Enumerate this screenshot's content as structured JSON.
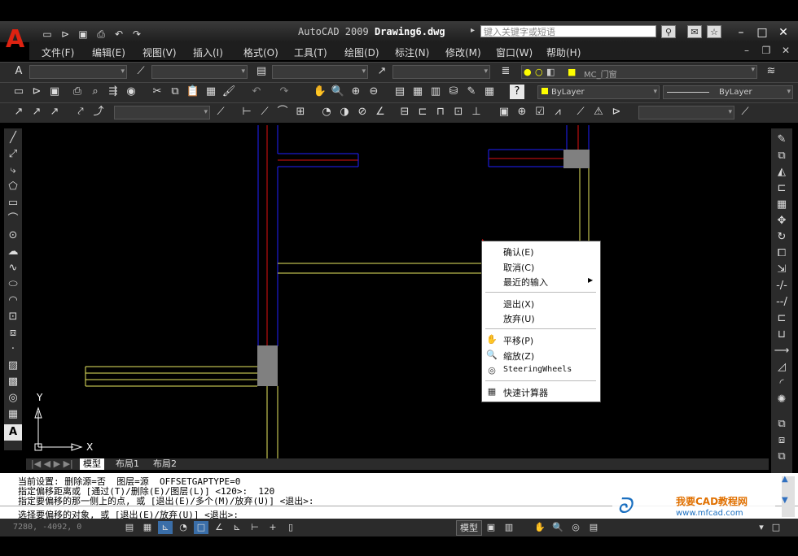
{
  "title": {
    "app": "AutoCAD 2009",
    "file": "Drawing6.dwg",
    "search_placeholder": "键入关键字或短语"
  },
  "menu": [
    "文件(F)",
    "编辑(E)",
    "视图(V)",
    "插入(I)",
    "格式(O)",
    "工具(T)",
    "绘图(D)",
    "标注(N)",
    "修改(M)",
    "窗口(W)",
    "帮助(H)"
  ],
  "toolbar": {
    "layer_name": "MC_门窗",
    "color_value": "ByLayer",
    "linetype_value": "ByLayer"
  },
  "layout_tabs": [
    "模型",
    "布局1",
    "布局2"
  ],
  "ucs": {
    "x_label": "X",
    "y_label": "Y"
  },
  "context_menu": {
    "confirm": "确认(E)",
    "cancel": "取消(C)",
    "recent_input": "最近的输入",
    "exit": "退出(X)",
    "undo": "放弃(U)",
    "pan": "平移(P)",
    "zoom": "缩放(Z)",
    "steeringwheels": "SteeringWheels",
    "quickcalc": "快速计算器"
  },
  "command_lines": [
    "当前设置: 删除源=否  图层=源  OFFSETGAPTYPE=0",
    "指定偏移距离或 [通过(T)/删除(E)/图层(L)] <120>:  120",
    "指定要偏移的那一侧上的点, 或 [退出(E)/多个(M)/放弃(U)] <退出>:",
    "选择要偏移的对象, 或 [退出(E)/放弃(U)] <退出>:"
  ],
  "status": {
    "coordinates": "7280,  -4092,  0",
    "model_label": "模型"
  },
  "watermark": {
    "name": "我要CAD教程网",
    "url": "www.mfcad.com"
  },
  "colors": {
    "wall_red": "#e01010",
    "wall_blue": "#2020ff",
    "window_yellow": "#e8e860",
    "column_gray": "#808080",
    "cursor_red": "#ee1111"
  }
}
